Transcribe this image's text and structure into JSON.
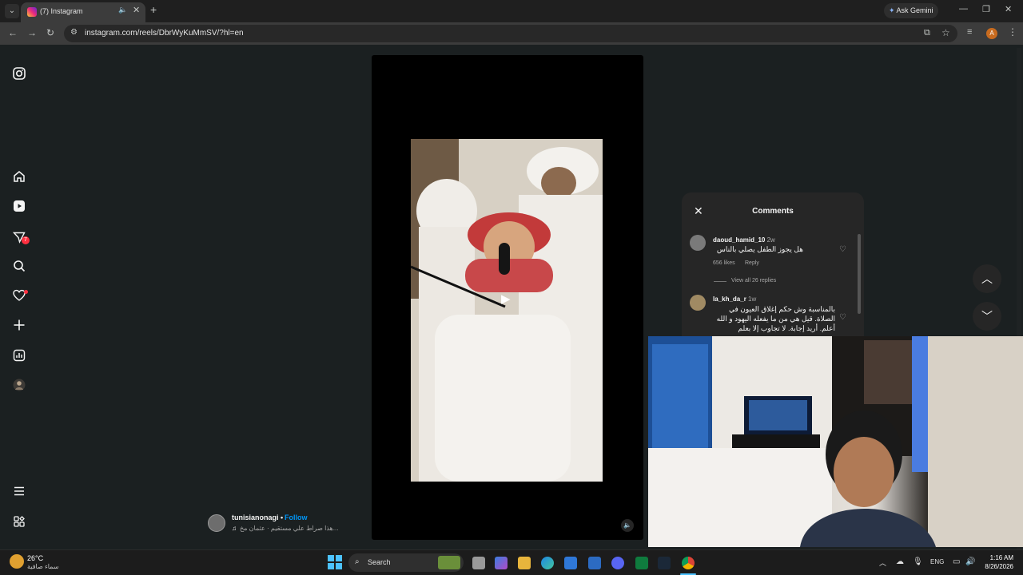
{
  "browser": {
    "tab_title": "(7) Instagram",
    "url": "instagram.com/reels/DbrWyKuMmSV/?hl=en",
    "gemini_label": "Ask Gemini",
    "profile_initial": "A"
  },
  "sidebar": {
    "notifications_count": "7",
    "items": [
      "instagram-logo",
      "home-icon",
      "reels-icon",
      "messages-icon",
      "search-icon",
      "notifications-icon",
      "create-icon",
      "dashboard-icon",
      "profile-avatar",
      "more-menu-icon",
      "also-from-meta-icon"
    ]
  },
  "reel": {
    "author": "tunisianonagi",
    "follow": "Follow",
    "audio": "هذا صراط علي مستقيم · عثمان مخ..."
  },
  "comments": {
    "title": "Comments",
    "items": [
      {
        "user": "daoud_hamid_10",
        "time": "2w",
        "text": "هل يجوز الطفل يصلي بالناس",
        "likes": "656 likes",
        "reply": "Reply",
        "view_replies": "View all 26 replies"
      },
      {
        "user": "la_kh_da_r",
        "time": "1w",
        "text": "بالمناسبة وش حكم إغلاق العيون في الصلاة. قيل هي من ما يفعله اليهود و الله أعلم. أريد إجابة. لا تجاوب إلا بعلم"
      }
    ]
  },
  "taskbar": {
    "weather_temp": "26°C",
    "weather_desc": "سماء صافية",
    "search_label": "Search",
    "lang": "ENG",
    "time": "1:16 AM",
    "date": "8/26/2026"
  }
}
